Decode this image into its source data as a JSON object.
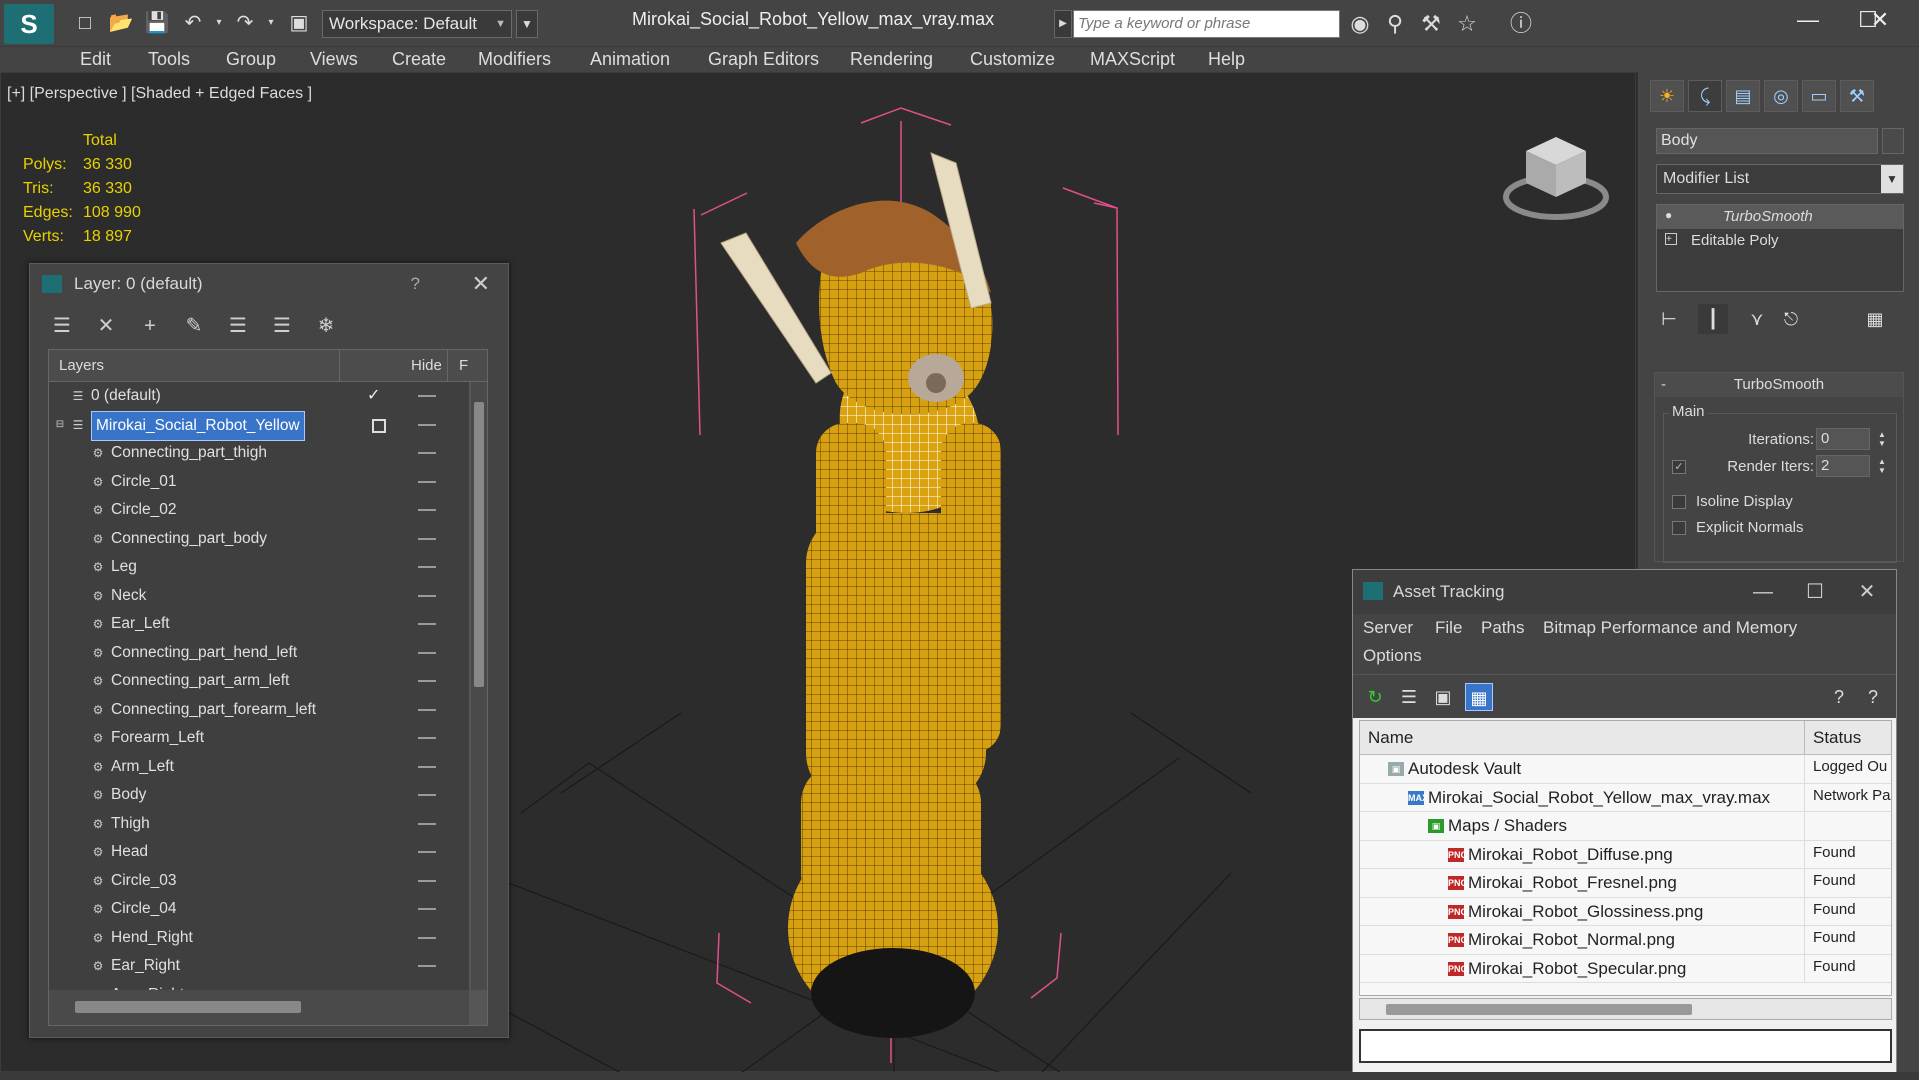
{
  "titlebar": {
    "workspace_label": "Workspace: Default",
    "document_title": "Mirokai_Social_Robot_Yellow_max_vray.max",
    "search_placeholder": "Type a keyword or phrase"
  },
  "menu": [
    "Edit",
    "Tools",
    "Group",
    "Views",
    "Create",
    "Modifiers",
    "Animation",
    "Graph Editors",
    "Rendering",
    "Customize",
    "MAXScript",
    "Help"
  ],
  "viewport": {
    "label": "[+] [Perspective ] [Shaded + Edged Faces ]",
    "stats": {
      "header": "Total",
      "rows": [
        {
          "label": "Polys:",
          "value": "36 330"
        },
        {
          "label": "Tris:",
          "value": "36 330"
        },
        {
          "label": "Edges:",
          "value": "108 990"
        },
        {
          "label": "Verts:",
          "value": "18 897"
        }
      ]
    }
  },
  "layer_dialog": {
    "title": "Layer: 0 (default)",
    "help": "?",
    "columns": {
      "layers": "Layers",
      "hide": "Hide",
      "freeze": "F"
    },
    "rows": [
      {
        "name": "0 (default)",
        "level": 0,
        "type": "layer",
        "current": true
      },
      {
        "name": "Mirokai_Social_Robot_Yellow",
        "level": 0,
        "type": "layer",
        "selected": true
      },
      {
        "name": "Connecting_part_thigh",
        "level": 1,
        "type": "object"
      },
      {
        "name": "Circle_01",
        "level": 1,
        "type": "object"
      },
      {
        "name": "Circle_02",
        "level": 1,
        "type": "object"
      },
      {
        "name": "Connecting_part_body",
        "level": 1,
        "type": "object"
      },
      {
        "name": "Leg",
        "level": 1,
        "type": "object"
      },
      {
        "name": "Neck",
        "level": 1,
        "type": "object"
      },
      {
        "name": "Ear_Left",
        "level": 1,
        "type": "object"
      },
      {
        "name": "Connecting_part_hend_left",
        "level": 1,
        "type": "object"
      },
      {
        "name": "Connecting_part_arm_left",
        "level": 1,
        "type": "object"
      },
      {
        "name": "Connecting_part_forearm_left",
        "level": 1,
        "type": "object"
      },
      {
        "name": "Forearm_Left",
        "level": 1,
        "type": "object"
      },
      {
        "name": "Arm_Left",
        "level": 1,
        "type": "object"
      },
      {
        "name": "Body",
        "level": 1,
        "type": "object"
      },
      {
        "name": "Thigh",
        "level": 1,
        "type": "object"
      },
      {
        "name": "Head",
        "level": 1,
        "type": "object"
      },
      {
        "name": "Circle_03",
        "level": 1,
        "type": "object"
      },
      {
        "name": "Circle_04",
        "level": 1,
        "type": "object"
      },
      {
        "name": "Hend_Right",
        "level": 1,
        "type": "object"
      },
      {
        "name": "Ear_Right",
        "level": 1,
        "type": "object"
      },
      {
        "name": "Arm_Right",
        "level": 1,
        "type": "object"
      }
    ]
  },
  "command_panel": {
    "object_name": "Body",
    "modifier_list": "Modifier List",
    "stack": [
      "TurboSmooth",
      "Editable Poly"
    ],
    "turbosmooth": {
      "title": "TurboSmooth",
      "group": "Main",
      "iterations_label": "Iterations:",
      "iterations": "0",
      "render_iters_label": "Render Iters:",
      "render_iters": "2",
      "render_iters_checked": true,
      "isoline_label": "Isoline Display",
      "explicit_normals_label": "Explicit Normals"
    }
  },
  "asset_tracking": {
    "title": "Asset Tracking",
    "menu": [
      "Server",
      "File",
      "Paths",
      "Bitmap Performance and Memory",
      "Options"
    ],
    "columns": {
      "name": "Name",
      "status": "Status"
    },
    "rows": [
      {
        "name": "Autodesk Vault",
        "status": "Logged Ou",
        "level": 1,
        "icon": "vault"
      },
      {
        "name": "Mirokai_Social_Robot_Yellow_max_vray.max",
        "status": "Network Pa",
        "level": 2,
        "icon": "max"
      },
      {
        "name": "Maps / Shaders",
        "status": "",
        "level": 3,
        "icon": "maps"
      },
      {
        "name": "Mirokai_Robot_Diffuse.png",
        "status": "Found",
        "level": 4,
        "icon": "png"
      },
      {
        "name": "Mirokai_Robot_Fresnel.png",
        "status": "Found",
        "level": 4,
        "icon": "png"
      },
      {
        "name": "Mirokai_Robot_Glossiness.png",
        "status": "Found",
        "level": 4,
        "icon": "png"
      },
      {
        "name": "Mirokai_Robot_Normal.png",
        "status": "Found",
        "level": 4,
        "icon": "png"
      },
      {
        "name": "Mirokai_Robot_Specular.png",
        "status": "Found",
        "level": 4,
        "icon": "png"
      }
    ]
  },
  "colors": {
    "stats": "#e8d200",
    "selection": "#3874c8",
    "accent": "#1d6f73",
    "wire": "#e0a000",
    "bbox": "#e0508c"
  }
}
